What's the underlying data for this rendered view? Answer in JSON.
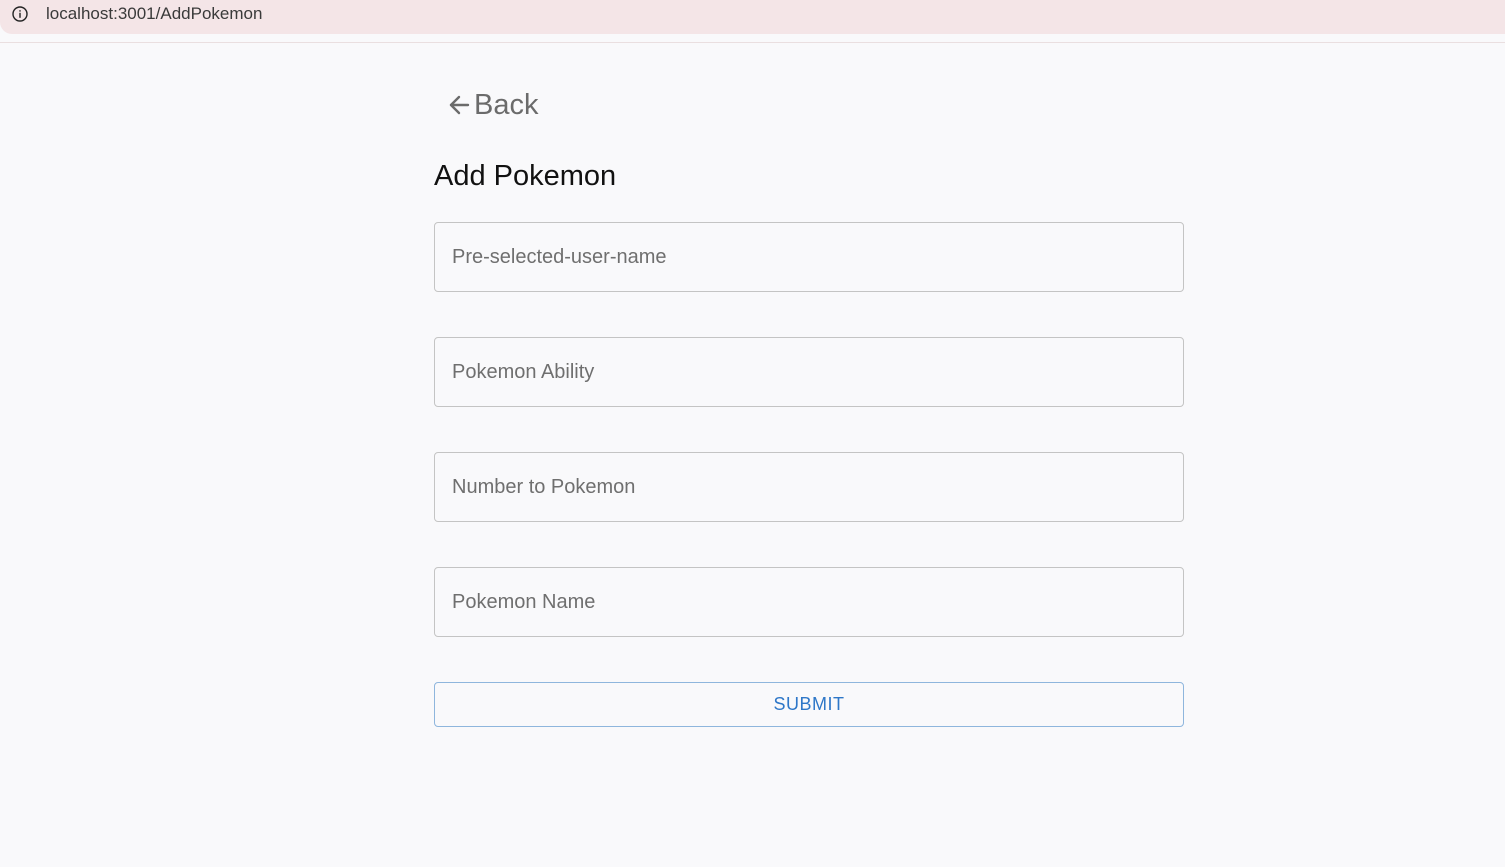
{
  "browser": {
    "url": "localhost:3001/AddPokemon",
    "info_icon": "info-icon"
  },
  "nav": {
    "back_label": "Back",
    "back_icon": "arrow-left-icon"
  },
  "form": {
    "title": "Add Pokemon",
    "fields": [
      {
        "placeholder": "Pre-selected-user-name",
        "value": ""
      },
      {
        "placeholder": "Pokemon Ability",
        "value": ""
      },
      {
        "placeholder": "Number to Pokemon",
        "value": ""
      },
      {
        "placeholder": "Pokemon Name",
        "value": ""
      }
    ],
    "submit_label": "SUBMIT"
  },
  "colors": {
    "page_background": "#f9f9fb",
    "address_bar": "#f4e5e7",
    "accent": "#2e77c8",
    "border": "#c4c4c4"
  }
}
